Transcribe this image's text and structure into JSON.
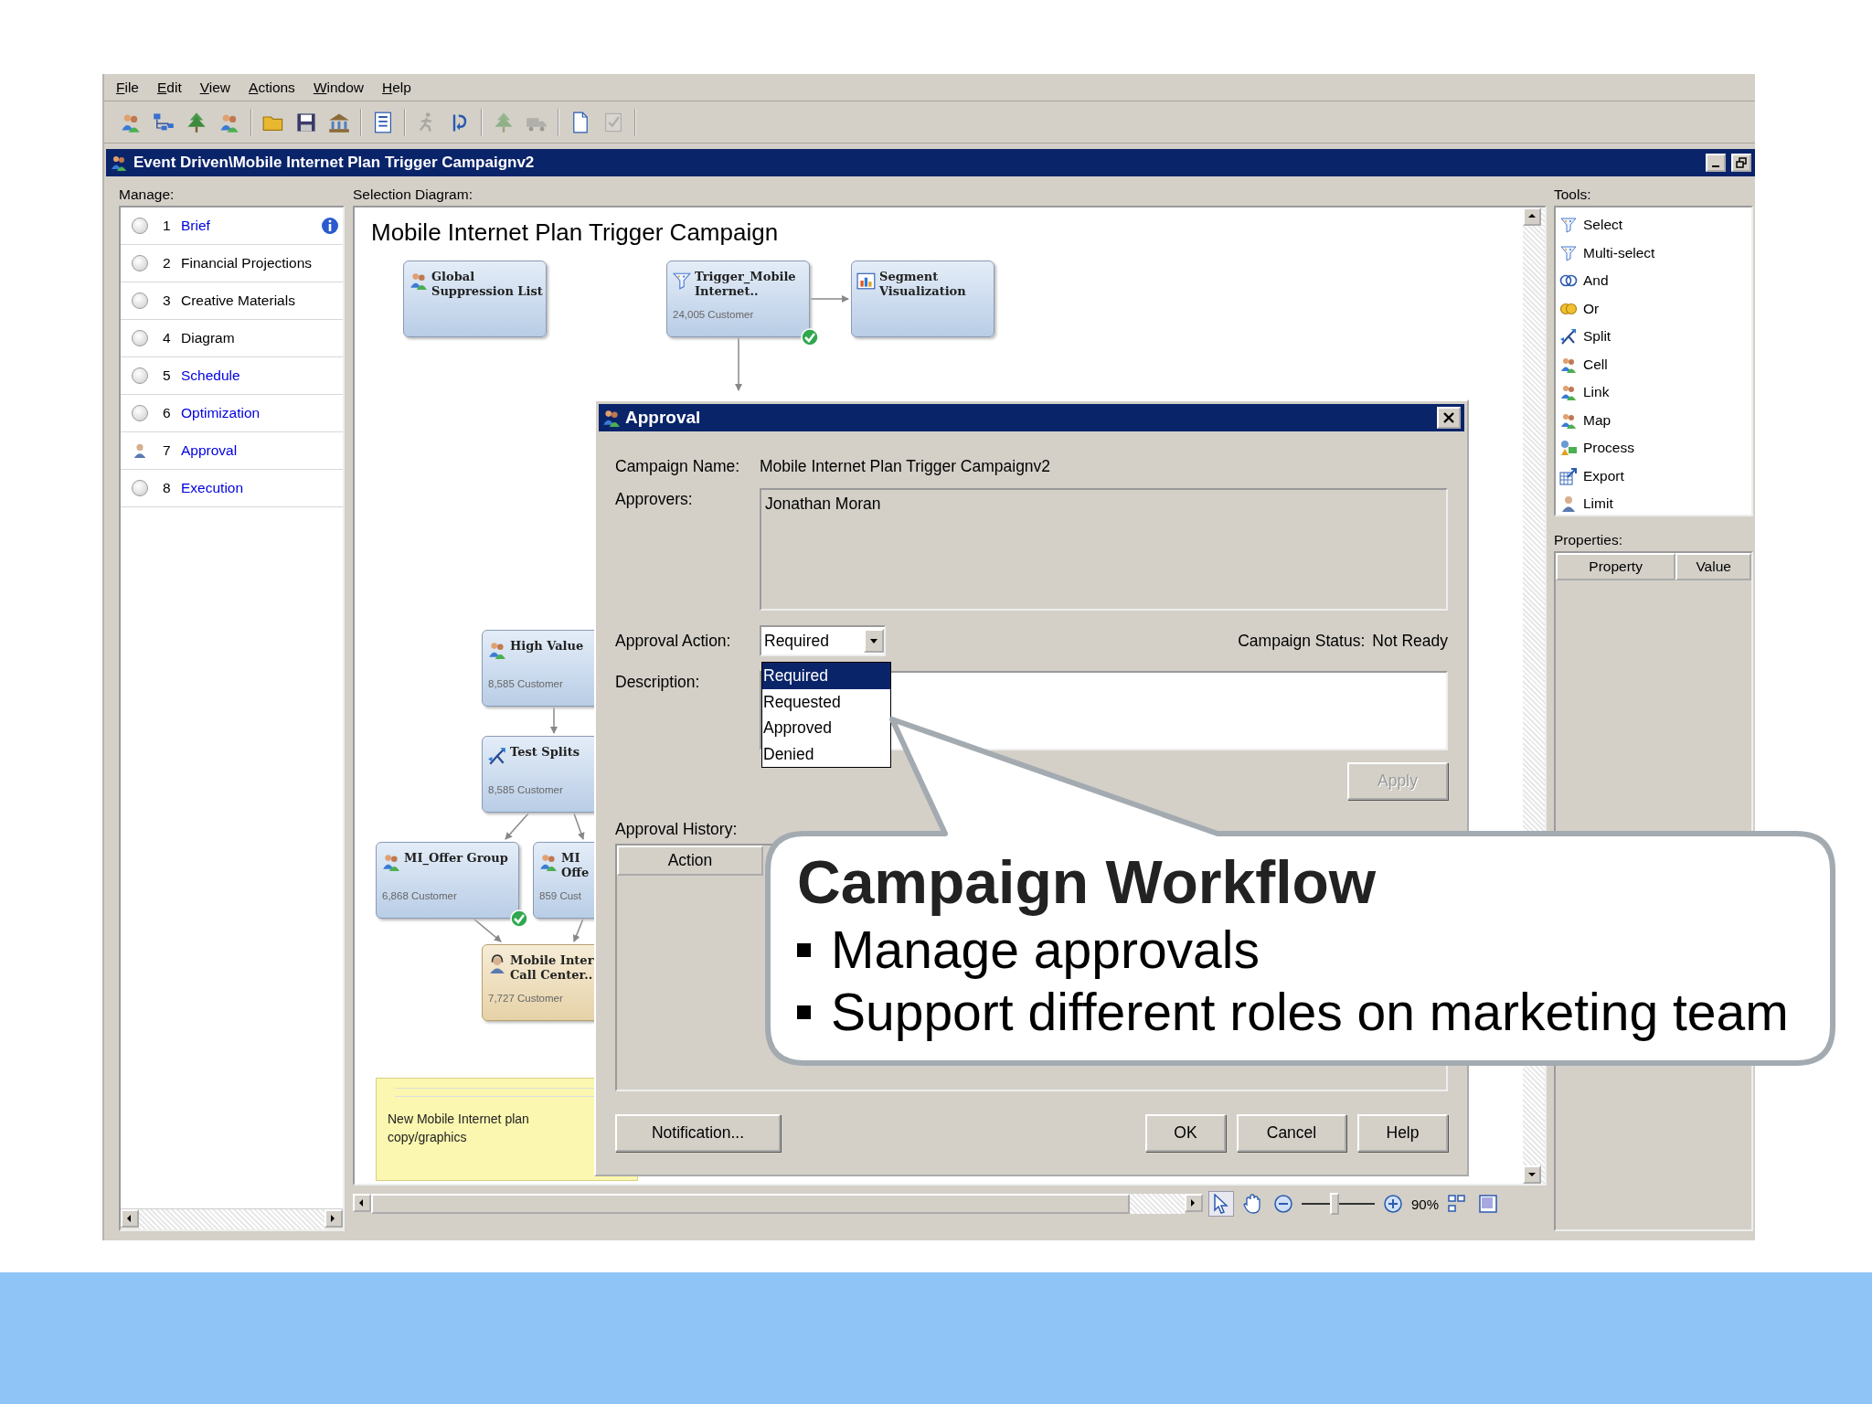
{
  "menu": [
    {
      "label": "File"
    },
    {
      "label": "Edit"
    },
    {
      "label": "View"
    },
    {
      "label": "Actions"
    },
    {
      "label": "Window"
    },
    {
      "label": "Help"
    }
  ],
  "toolbar_groups": [
    [
      {
        "kind": "people",
        "disabled": false
      },
      {
        "kind": "hierarchy",
        "disabled": false
      },
      {
        "kind": "tree",
        "disabled": false
      },
      {
        "kind": "people",
        "disabled": false
      }
    ],
    [
      {
        "kind": "folder",
        "disabled": false
      },
      {
        "kind": "save",
        "disabled": false
      },
      {
        "kind": "building",
        "disabled": false
      }
    ],
    [
      {
        "kind": "list",
        "disabled": false
      }
    ],
    [
      {
        "kind": "runner",
        "disabled": true
      },
      {
        "kind": "arrow",
        "disabled": false
      }
    ],
    [
      {
        "kind": "tree",
        "disabled": true
      },
      {
        "kind": "truck",
        "disabled": true
      }
    ],
    [
      {
        "kind": "page",
        "disabled": false
      },
      {
        "kind": "checklist",
        "disabled": true
      }
    ]
  ],
  "document": {
    "title": "Event Driven\\Mobile Internet Plan Trigger Campaignv2",
    "manage": {
      "label": "Manage:",
      "steps": [
        {
          "number": "1",
          "label": "Brief",
          "linked": true,
          "assigned": false,
          "info": true
        },
        {
          "number": "2",
          "label": "Financial Projections",
          "linked": false,
          "assigned": false,
          "info": false
        },
        {
          "number": "3",
          "label": "Creative Materials",
          "linked": false,
          "assigned": false,
          "info": false
        },
        {
          "number": "4",
          "label": "Diagram",
          "linked": false,
          "assigned": false,
          "info": false
        },
        {
          "number": "5",
          "label": "Schedule",
          "linked": true,
          "assigned": false,
          "info": false
        },
        {
          "number": "6",
          "label": "Optimization",
          "linked": true,
          "assigned": false,
          "info": false
        },
        {
          "number": "7",
          "label": "Approval",
          "linked": true,
          "assigned": true,
          "info": false
        },
        {
          "number": "8",
          "label": "Execution",
          "linked": true,
          "assigned": false,
          "info": false
        }
      ]
    },
    "diagram": {
      "label": "Selection Diagram:",
      "title": "Mobile Internet Plan Trigger Campaign",
      "nodes": [
        {
          "kind": "people",
          "highlighted": false,
          "lines": [
            "Global",
            "Suppression List"
          ],
          "checked": false
        },
        {
          "kind": "select",
          "highlighted": false,
          "lines": [
            "Trigger_Mobile",
            "Internet.."
          ],
          "count": "24,005 Customer",
          "checked": true
        },
        {
          "kind": "chart",
          "highlighted": false,
          "lines": [
            "Segment",
            "Visualization"
          ],
          "checked": false
        },
        {
          "kind": "people",
          "highlighted": false,
          "lines": [
            "High Value"
          ],
          "count": "8,585 Customer"
        },
        {
          "kind": "split",
          "highlighted": false,
          "lines": [
            "Test Splits"
          ],
          "count": "8,585 Customer"
        },
        {
          "kind": "people",
          "highlighted": false,
          "lines": [
            "MI_Offer Group"
          ],
          "count": "6,868 Customer",
          "checked": true
        },
        {
          "kind": "people",
          "highlighted": false,
          "lines": [
            "MI",
            "Offe"
          ],
          "count": "859 Cust"
        },
        {
          "kind": "headset",
          "highlighted": true,
          "lines": [
            "Mobile Inter",
            "Call Center.."
          ],
          "count": "7,727 Customer"
        }
      ],
      "note": {
        "text": "New Mobile Internet plan copy/graphics"
      }
    },
    "zoom": {
      "reading": "90%",
      "level": 0.45
    },
    "tools": {
      "label": "Tools:",
      "items": [
        {
          "label": "Select",
          "kind": "select"
        },
        {
          "label": "Multi-select",
          "kind": "multiselect"
        },
        {
          "label": "And",
          "kind": "and"
        },
        {
          "label": "Or",
          "kind": "or"
        },
        {
          "label": "Split",
          "kind": "split"
        },
        {
          "label": "Cell",
          "kind": "cell"
        },
        {
          "label": "Link",
          "kind": "link"
        },
        {
          "label": "Map",
          "kind": "map"
        },
        {
          "label": "Process",
          "kind": "process"
        },
        {
          "label": "Export",
          "kind": "export"
        },
        {
          "label": "Limit",
          "kind": "limit"
        }
      ]
    },
    "properties": {
      "label": "Properties:",
      "columns": [
        "Property",
        "Value"
      ]
    }
  },
  "dialog": {
    "title": "Approval",
    "campaign_name_label": "Campaign Name:",
    "campaign_name": "Mobile Internet Plan Trigger Campaignv2",
    "approvers_label": "Approvers:",
    "approvers": [
      "Jonathan Moran"
    ],
    "action_label": "Approval Action:",
    "action_value": "Required",
    "action_options": [
      {
        "label": "Required",
        "selected": true
      },
      {
        "label": "Requested",
        "selected": false
      },
      {
        "label": "Approved",
        "selected": false
      },
      {
        "label": "Denied",
        "selected": false
      }
    ],
    "status_label": "Campaign Status:",
    "status_value": "Not Ready",
    "description_label": "Description:",
    "apply": {
      "label": "Apply",
      "disabled": true
    },
    "history_label": "Approval History:",
    "history_columns": [
      "Action"
    ],
    "notification_button": "Notification...",
    "buttons": [
      "OK",
      "Cancel",
      "Help"
    ]
  },
  "callout": {
    "title": "Campaign Workflow",
    "bullets": [
      "Manage approvals",
      "Support different roles on marketing team"
    ]
  }
}
